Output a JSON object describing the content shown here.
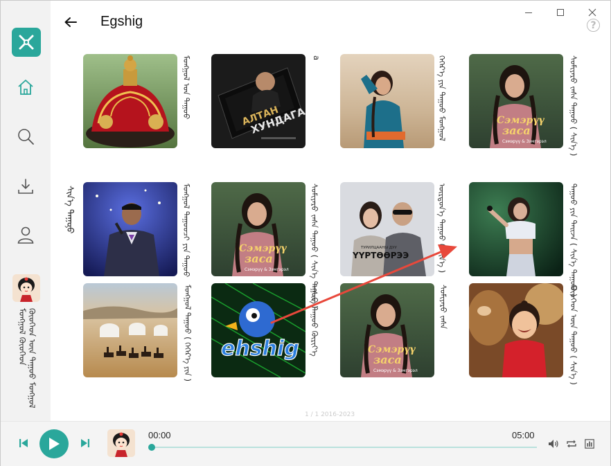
{
  "app": {
    "title": "Egshig"
  },
  "window_controls": [
    "minimize-icon",
    "maximize-icon",
    "close-icon"
  ],
  "sidebar": {
    "items": [
      {
        "name": "home",
        "icon": "home-icon",
        "active": true
      },
      {
        "name": "search",
        "icon": "search-icon",
        "active": false
      },
      {
        "name": "download",
        "icon": "download-icon",
        "active": false
      },
      {
        "name": "profile",
        "icon": "user-icon",
        "active": false
      }
    ],
    "now_playing_lines": [
      "ᠮᠣᠩᠭᠣᠯ ᠬᠦᠦᠬᠡᠳ",
      "ᠬᠦᠦᠬᠡᠳ ᠦᠨ ᠳᠠᠭᠤᠤ ᠮᠣᠩᠭᠣᠯ"
    ]
  },
  "section": {
    "label": "ᠰᠢᠨ᠎ᠡ ᠳᠠᠭᠤᠤ"
  },
  "cards": [
    {
      "id": "c1",
      "title": "ᠮᠣᠩᠭᠣᠯ ᠤᠨ ᠳᠠᠭᠤᠤ",
      "cover": "mongolian-hat"
    },
    {
      "id": "c2",
      "title": "a",
      "cover": "altan-khundaga"
    },
    {
      "id": "c3",
      "title": "ᠬᠡᠭᠡᠷ᠎ᠡ ᠶᠢᠨ ᠳᠠᠭᠤᠤ ᠮᠣᠩᠭᠣᠯ",
      "cover": "steppe-girl"
    },
    {
      "id": "c4",
      "title": "ᠰᠣᠮᠢᠶᠠᠷᠤ ᠵᠠᠰᠠ ᠳᠠᠭᠤᠤ ( ᠰᠢᠨ᠎ᠡ )",
      "cover": "smeru-zasa"
    },
    {
      "id": "c5",
      "title": "ᠮᠣᠩᠭᠣᠯ ᠳᠠᠭᠤᠤᠴᠢ ᠶᠢᠨ ᠳᠠᠭᠤᠤ",
      "cover": "singer-stage"
    },
    {
      "id": "c6",
      "title": "ᠰᠣᠮᠢᠶᠠᠷᠤ ᠵᠠᠰᠠ ᠳᠠᠭᠤᠤ ( ᠰᠢᠨ᠎ᠡ ᠳᠠᠭᠤᠤ )",
      "cover": "smeru-zasa"
    },
    {
      "id": "c7",
      "title": "ᠦᠷᠳᠦᠨ᠎ᠡ ᠳᠠᠭᠤᠤ ( ᠰᠢᠨ᠎ᠡ )",
      "cover": "urtuuchuud"
    },
    {
      "id": "c8",
      "title": "ᠳᠠᠭᠤᠤ ᠶᠢᠨ ᠲᠠᠢᠵᠠ ( ᠰᠢᠨ᠎ᠡ ᠳᠠᠭᠤᠤ )",
      "cover": "concert-girl"
    },
    {
      "id": "c9",
      "title": "ᠮᠣᠩᠭᠣᠯ ᠳᠠᠭᠤᠤ ( ᠬᠡᠭᠡᠷ᠎ᠡ ᠶᠢᠨ )",
      "cover": "yurt-horses"
    },
    {
      "id": "c10",
      "title": "ᠡᠭᠰᠢᠭ ᠳᠠᠭᠤᠤ ᠬᠦᠷᠢᠶ᠎ᠡ",
      "cover": "ehshig-logo"
    },
    {
      "id": "c11",
      "title": "ᠰᠣᠮᠢᠶᠠᠷᠤ ᠵᠠᠰᠠ",
      "cover": "smeru-zasa"
    },
    {
      "id": "c12",
      "title": "ᠬᠦᠦᠬᠡᠳ ᠦᠨ ᠳᠠᠭᠤᠤ ( ᠰᠢᠨ᠎ᠡ )",
      "cover": "child-calf"
    }
  ],
  "cover_text": {
    "altan": "АЛТАН",
    "khundaga": "ХУНДАГА",
    "smeru": "Сэмэрүү",
    "zasa": "засa",
    "smeru_sub": "Сэмэрүү & Зэмгэрэл",
    "urt_small": "ТУРИЛЦААНЫ ДУУ",
    "urt_big": "ҮҮРТӨӨРЭЭ",
    "ehshig": "ehshig"
  },
  "footer_hint": "1 / 1  2016-2023",
  "player": {
    "current_time": "00:00",
    "total_time": "05:00",
    "progress": 0.0,
    "controls": [
      "prev-icon",
      "play-icon",
      "next-icon"
    ],
    "right_controls": [
      "volume-icon",
      "repeat-icon",
      "equalizer-icon"
    ]
  },
  "colors": {
    "accent": "#2aa79b",
    "sidebar_bg": "#f2f2f2",
    "arrow": "#e8483b"
  }
}
